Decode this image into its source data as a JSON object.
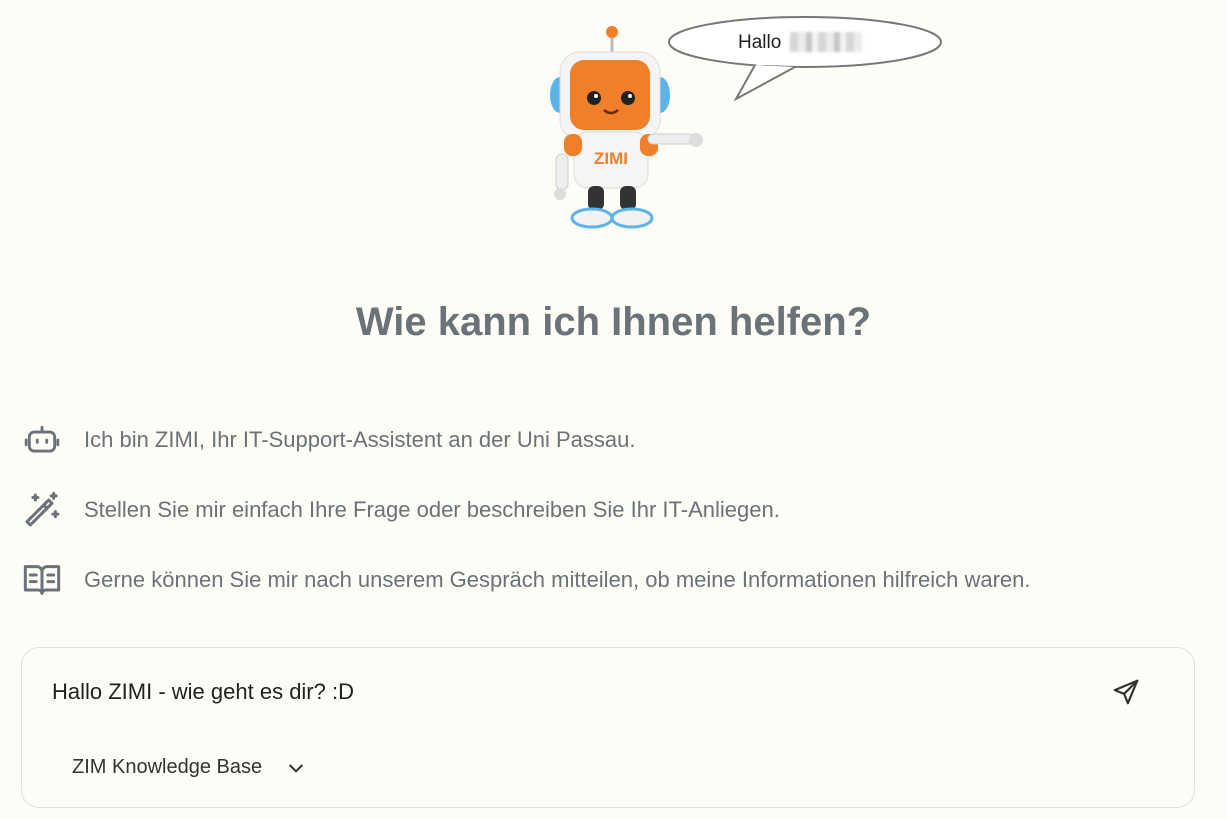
{
  "hero": {
    "mascot_name": "ZIMI",
    "speech_bubble": "Hallo"
  },
  "heading": "Wie kann ich Ihnen helfen?",
  "info_items": [
    {
      "icon": "robot-icon",
      "text": "Ich bin ZIMI, Ihr IT-Support-Assistent an der Uni Passau."
    },
    {
      "icon": "magic-wand-icon",
      "text": "Stellen Sie mir einfach Ihre Frage oder beschreiben Sie Ihr IT-Anliegen."
    },
    {
      "icon": "book-open-icon",
      "text": "Gerne können Sie mir nach unserem Gespräch mitteilen, ob meine Informationen hilfreich waren."
    }
  ],
  "composer": {
    "input_value": "Hallo ZIMI - wie geht es dir? :D",
    "send_icon": "send-icon",
    "knowledge_base": "ZIM Knowledge Base",
    "dropdown_icon": "chevron-down-icon"
  },
  "colors": {
    "background": "#fdfcf7",
    "text_muted": "#6b7278",
    "robot_orange": "#f07f2a",
    "robot_blue": "#5ab4e8"
  }
}
